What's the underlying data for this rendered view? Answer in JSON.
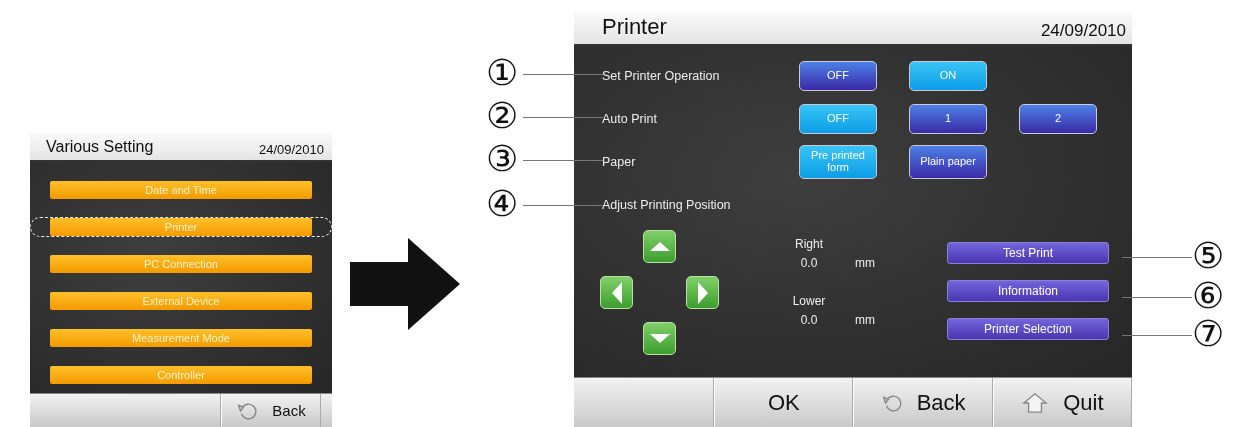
{
  "left_screen": {
    "title": "Various Setting",
    "date": "24/09/2010",
    "menu": [
      {
        "label": "Date and Time",
        "highlighted": false
      },
      {
        "label": "Printer",
        "highlighted": true
      },
      {
        "label": "PC Connection",
        "highlighted": false
      },
      {
        "label": "External Device",
        "highlighted": false
      },
      {
        "label": "Measurement Mode",
        "highlighted": false
      },
      {
        "label": "Controller",
        "highlighted": false
      }
    ],
    "footer_buttons": [
      {
        "label": "Back",
        "kind": "back"
      }
    ]
  },
  "right_screen": {
    "title": "Printer",
    "date": "24/09/2010",
    "settings": [
      {
        "callout": "①",
        "label": "Set Printer Operation",
        "options": [
          {
            "label": "OFF",
            "selected": false
          },
          {
            "label": "ON",
            "selected": true
          }
        ]
      },
      {
        "callout": "②",
        "label": "Auto Print",
        "options": [
          {
            "label": "OFF",
            "selected": true
          },
          {
            "label": "1",
            "selected": false
          },
          {
            "label": "2",
            "selected": false
          }
        ]
      },
      {
        "callout": "③",
        "label": "Paper",
        "options": [
          {
            "label": "Pre printed form",
            "selected": true
          },
          {
            "label": "Plain paper",
            "selected": false
          }
        ]
      },
      {
        "callout": "④",
        "label": "Adjust Printing Position"
      }
    ],
    "readings": [
      {
        "label": "Right",
        "value": "0.0",
        "unit": "mm"
      },
      {
        "label": "Lower",
        "value": "0.0",
        "unit": "mm"
      }
    ],
    "actions": [
      {
        "label": "Test Print",
        "callout": "⑤"
      },
      {
        "label": "Information",
        "callout": "⑥"
      },
      {
        "label": "Printer Selection",
        "callout": "⑦"
      }
    ],
    "footer_buttons": [
      {
        "label": "OK",
        "kind": "plain"
      },
      {
        "label": "Back",
        "kind": "back"
      },
      {
        "label": "Quit",
        "kind": "home"
      }
    ]
  }
}
